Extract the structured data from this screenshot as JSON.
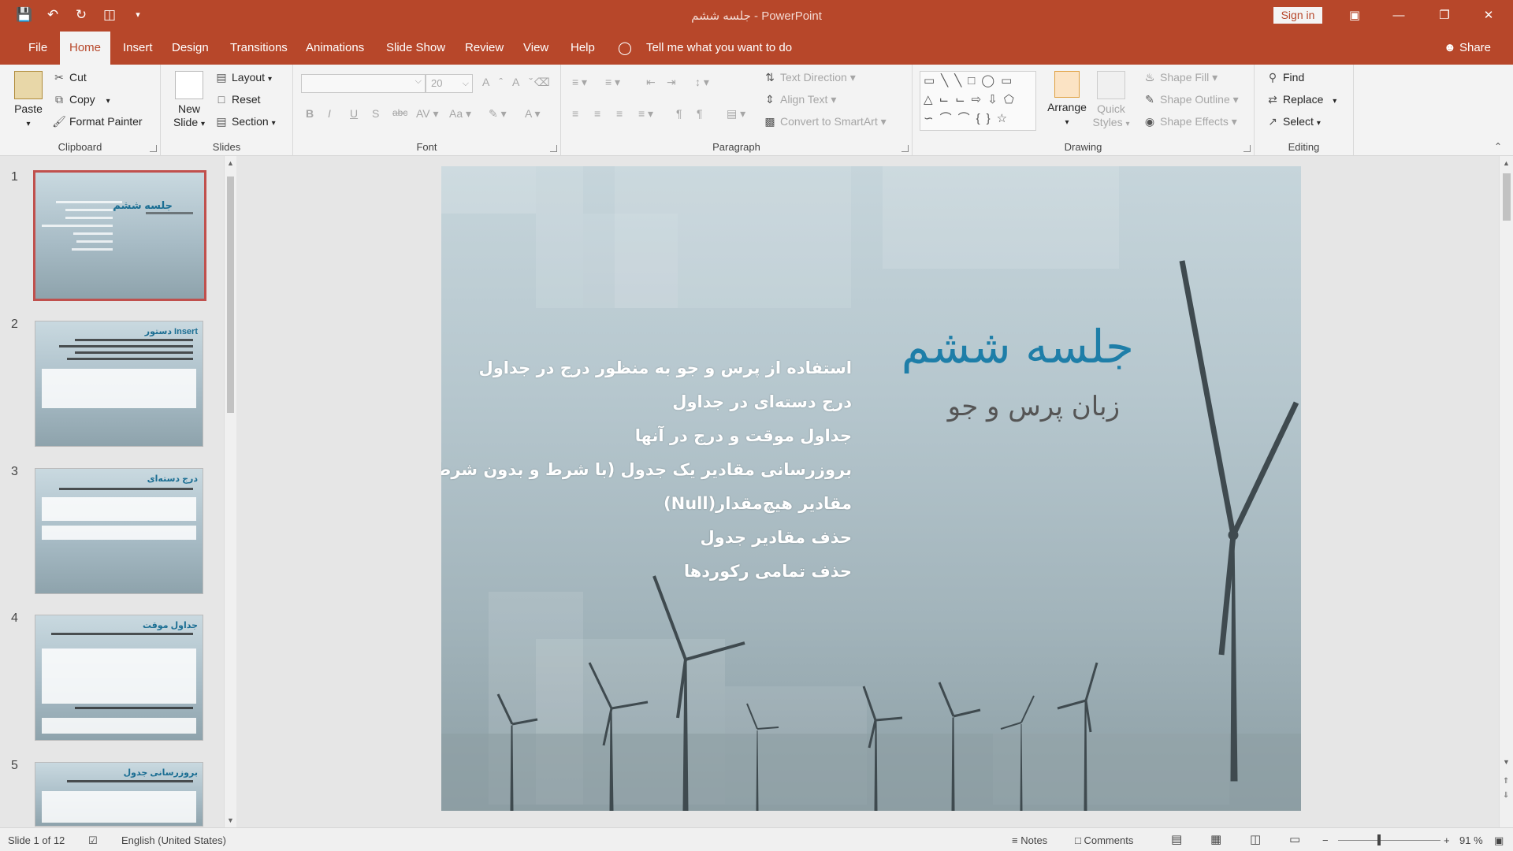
{
  "window": {
    "title": "جلسه ششم - PowerPoint",
    "signin_label": "Sign in"
  },
  "qat": {
    "save_icon": "save-icon",
    "undo_icon": "undo-icon",
    "redo_icon": "repeat-icon",
    "present_icon": "start-from-beginning-icon"
  },
  "tabs": [
    "File",
    "Home",
    "Insert",
    "Design",
    "Transitions",
    "Animations",
    "Slide Show",
    "Review",
    "View",
    "Help"
  ],
  "active_tab": "Home",
  "tell_me": "Tell me what you want to do",
  "share_label": "Share",
  "ribbon": {
    "clipboard": {
      "paste": "Paste",
      "cut": "Cut",
      "copy": "Copy",
      "format_painter": "Format Painter",
      "label": "Clipboard"
    },
    "slides": {
      "new_slide_1": "New",
      "new_slide_2": "Slide",
      "layout": "Layout",
      "reset": "Reset",
      "section": "Section",
      "label": "Slides"
    },
    "font": {
      "font_name": "",
      "font_size": "20",
      "label": "Font"
    },
    "paragraph": {
      "text_direction": "Text Direction",
      "align_text": "Align Text",
      "convert_smartart": "Convert to SmartArt",
      "label": "Paragraph"
    },
    "drawing": {
      "arrange": "Arrange",
      "quick_styles_1": "Quick",
      "quick_styles_2": "Styles",
      "shape_fill": "Shape Fill",
      "shape_outline": "Shape Outline",
      "shape_effects": "Shape Effects",
      "label": "Drawing"
    },
    "editing": {
      "find": "Find",
      "replace": "Replace",
      "select": "Select",
      "label": "Editing"
    }
  },
  "thumbnails": [
    {
      "num": "1",
      "title": "جلسه ششم",
      "selected": true
    },
    {
      "num": "2",
      "title": "دستور Insert",
      "selected": false
    },
    {
      "num": "3",
      "title": "درج دسته‌ای",
      "selected": false
    },
    {
      "num": "4",
      "title": "جداول موقت",
      "selected": false
    },
    {
      "num": "5",
      "title": "بروزرسانی جدول",
      "selected": false
    }
  ],
  "slide": {
    "title": "جلسه ششم",
    "subtitle": "زبان پرس و جو",
    "bullets": [
      "استفاده از پرس و جو به منظور درج در جداول",
      "درج دسته‌ای در جداول",
      "جداول موقت و درج در آنها",
      "بروزرسانی مقادیر یک جدول (با شرط و بدون شرط)",
      "مقادیر هیچ‌مقدار(Null)",
      "حذف مقادیر جدول",
      "حذف تمامی رکوردها"
    ]
  },
  "status": {
    "slide_of": "Slide 1 of 12",
    "language": "English (United States)",
    "notes": "Notes",
    "comments": "Comments",
    "zoom": "91 %"
  },
  "colors": {
    "accent": "#b7472a",
    "title_blue": "#1e7ea8",
    "selection": "#c0504d"
  }
}
